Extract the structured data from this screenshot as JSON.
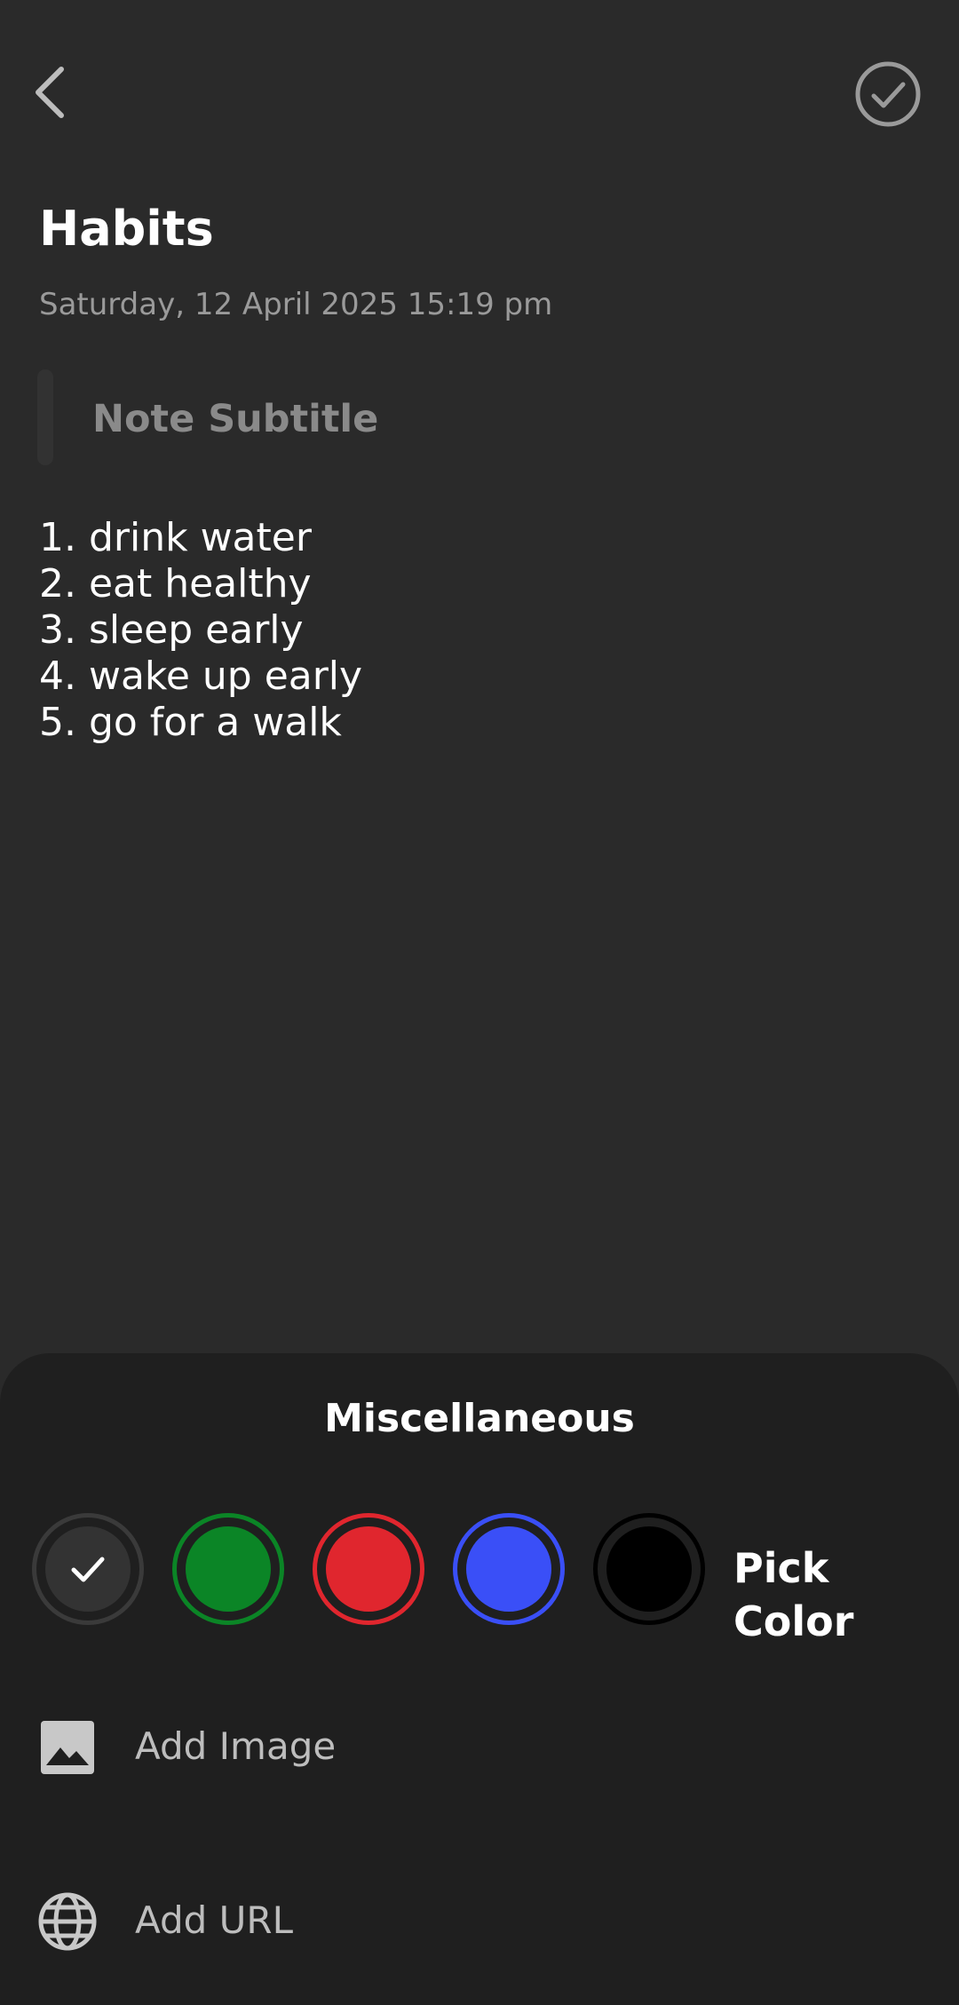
{
  "header": {
    "back_icon": "chevron-left-icon",
    "save_icon": "check-circle-icon"
  },
  "note": {
    "title": "Habits",
    "datetime": "Saturday, 12 April 2025 15:19 pm",
    "subtitle_placeholder": "Note Subtitle",
    "subtitle_value": "",
    "lines": [
      "1. drink water",
      "2. eat healthy",
      "3. sleep early",
      "4. wake up early",
      "5. go for a walk"
    ]
  },
  "sheet": {
    "title": "Miscellaneous",
    "colors": [
      {
        "name": "default",
        "hex": "#333333",
        "ring": "#3a3a3a",
        "selected": true
      },
      {
        "name": "green",
        "hex": "#0b8526",
        "ring": "#0b8526",
        "selected": false
      },
      {
        "name": "red",
        "hex": "#e0262e",
        "ring": "#e0262e",
        "selected": false
      },
      {
        "name": "blue",
        "hex": "#3a4ff7",
        "ring": "#3a4ff7",
        "selected": false
      },
      {
        "name": "black",
        "hex": "#000000",
        "ring": "#000000",
        "selected": false
      }
    ],
    "pick_color_label": "Pick Color",
    "add_image_label": "Add Image",
    "add_image_icon": "image-icon",
    "add_url_label": "Add URL",
    "add_url_icon": "globe-icon"
  }
}
